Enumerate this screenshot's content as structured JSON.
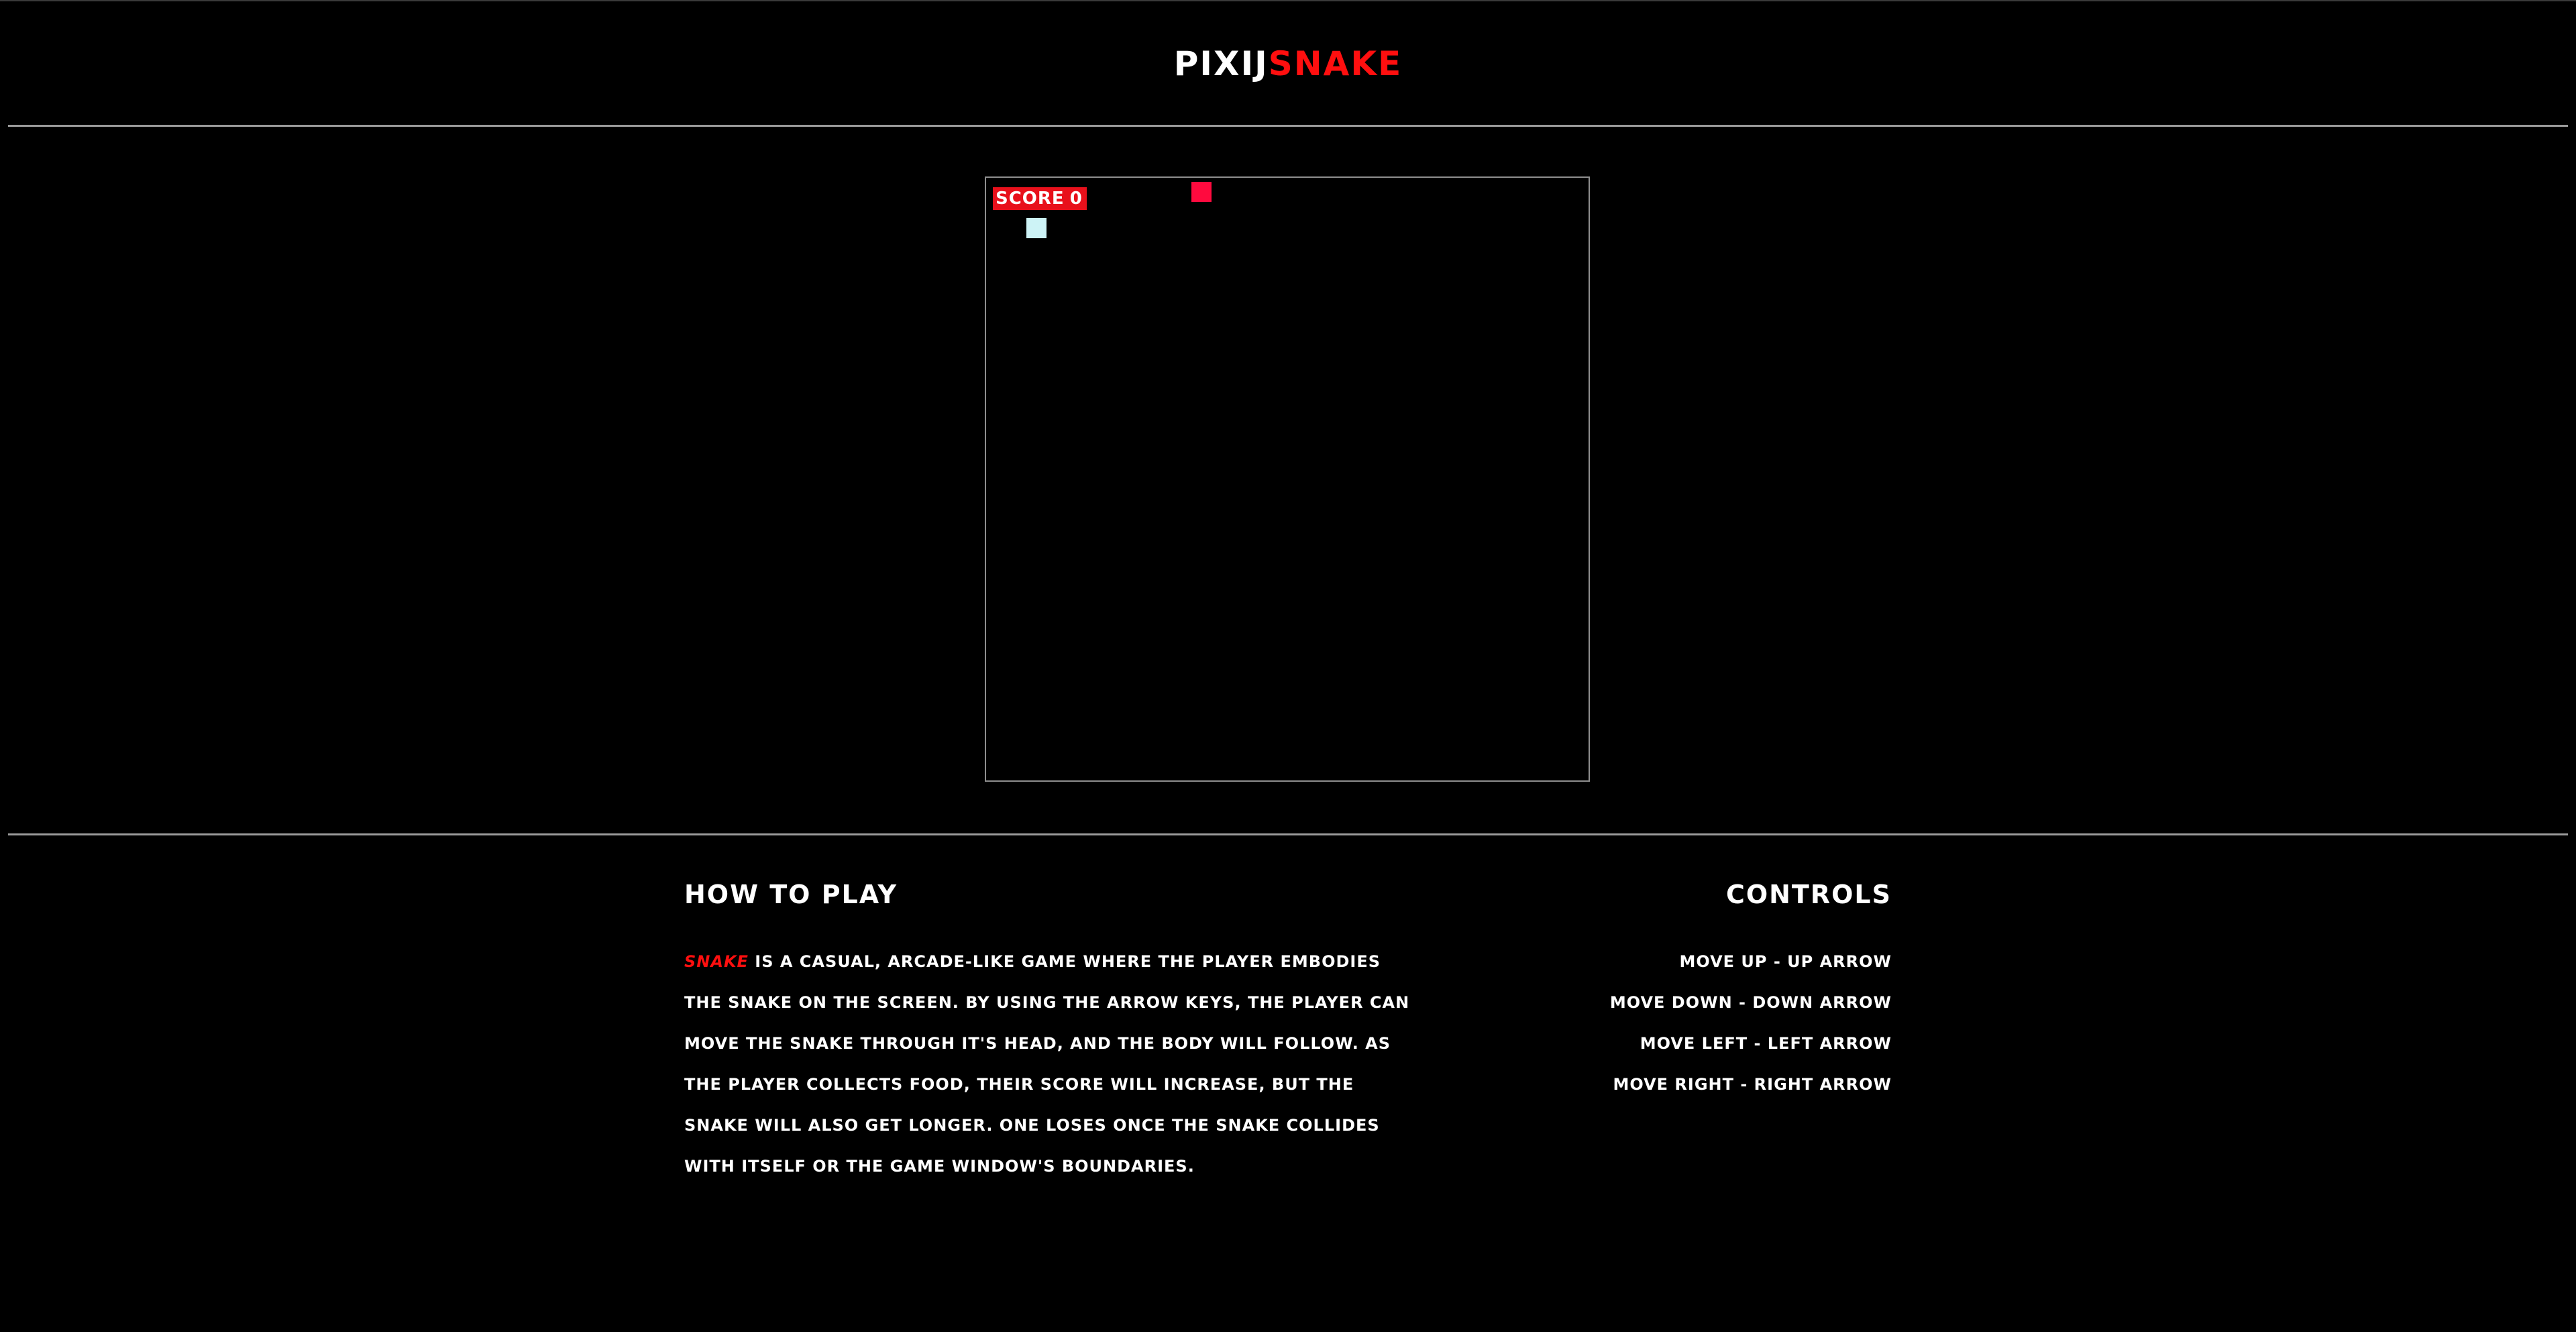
{
  "header": {
    "title_part1": "PIXIJ",
    "title_part2": "SNAKE"
  },
  "game": {
    "score_label": "SCORE",
    "score_value": "0",
    "colors": {
      "food": "#ff0a3e",
      "snake": "#cdf3f6",
      "score_badge": "#e8101b",
      "border": "#8e8e8e"
    }
  },
  "how_to_play": {
    "title": "HOW TO PLAY",
    "highlight": "SNAKE",
    "text": " IS A CASUAL, ARCADE-LIKE GAME WHERE THE PLAYER EMBODIES THE SNAKE ON THE SCREEN. BY USING THE ARROW KEYS, THE PLAYER CAN MOVE THE SNAKE THROUGH IT'S HEAD, AND THE BODY WILL FOLLOW. AS THE PLAYER COLLECTS FOOD, THEIR SCORE WILL INCREASE, BUT THE SNAKE WILL ALSO GET LONGER. ONE LOSES ONCE THE SNAKE COLLIDES WITH ITSELF OR THE GAME WINDOW'S BOUNDARIES."
  },
  "controls": {
    "title": "CONTROLS",
    "items": [
      "MOVE UP - UP ARROW",
      "MOVE DOWN - DOWN ARROW",
      "MOVE LEFT - LEFT ARROW",
      "MOVE RIGHT - RIGHT ARROW"
    ]
  }
}
